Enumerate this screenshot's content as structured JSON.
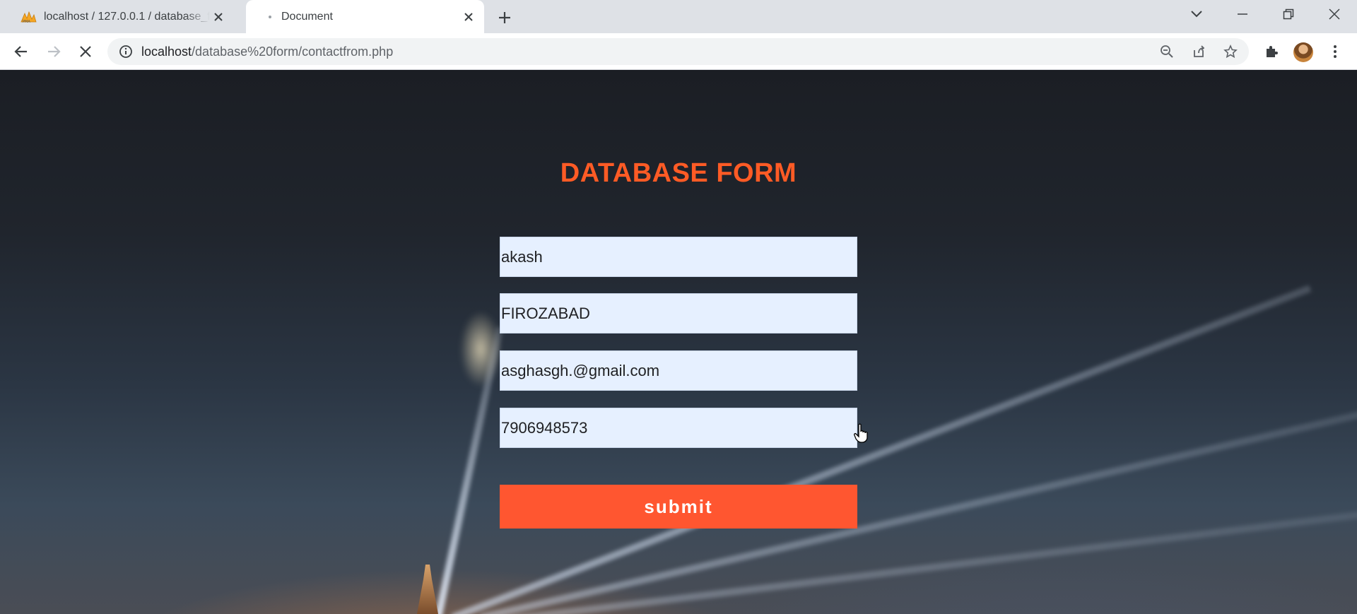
{
  "tabs": [
    {
      "title": "localhost / 127.0.0.1 / database_f",
      "active": false,
      "favicon": "phpmyadmin-icon"
    },
    {
      "title": "Document",
      "active": true,
      "favicon": "loading-dot-icon"
    }
  ],
  "toolbar": {
    "url_host": "localhost",
    "url_path": "/database%20form/contactfrom.php"
  },
  "form": {
    "title": "DATABASE FORM",
    "fields": [
      {
        "name": "name",
        "value": "akash"
      },
      {
        "name": "city",
        "value": "FIROZABAD"
      },
      {
        "name": "email",
        "value": "asghasgh.@gmail.com"
      },
      {
        "name": "phone",
        "value": "7906948573"
      }
    ],
    "submit_label": "submit"
  },
  "colors": {
    "accent": "#ff5630",
    "title": "#ff5b25",
    "input_bg": "#e6f0ff"
  }
}
